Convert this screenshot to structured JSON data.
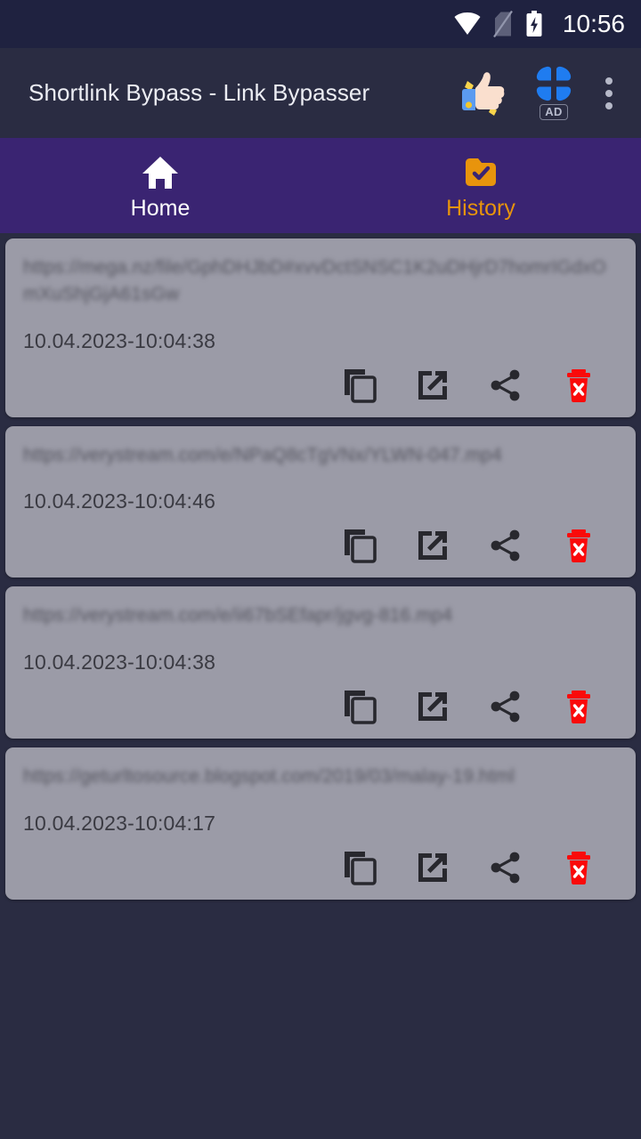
{
  "status_bar": {
    "clock": "10:56",
    "icons": [
      "wifi-icon",
      "sim-off-icon",
      "battery-charging-icon"
    ]
  },
  "app_bar": {
    "title": "Shortlink Bypass - Link Bypasser",
    "thumbs_up_icon": "thumbs-up-icon",
    "ad_icon": "ad-app-icon",
    "ad_badge_label": "AD",
    "overflow_icon": "more-vertical-icon"
  },
  "tabs": [
    {
      "label": "Home",
      "icon": "home-icon",
      "active": false
    },
    {
      "label": "History",
      "icon": "folder-check-icon",
      "active": true
    }
  ],
  "colors": {
    "status_bar_bg": "#1f2240",
    "app_bar_bg": "#2a2c42",
    "page_bg": "#2a2c42",
    "tab_bar_bg": "#3a2472",
    "tab_active": "#e8940c",
    "tab_inactive": "#ffffff",
    "card_bg": "#9b9ba7",
    "card_url_text": "#55555f",
    "card_date_text": "#3a3a42",
    "action_icon": "#28282e",
    "delete_icon": "#fa0a0a"
  },
  "actions": {
    "copy_label": "copy-icon",
    "open_label": "open-in-new-icon",
    "share_label": "share-icon",
    "delete_label": "delete-icon"
  },
  "history": [
    {
      "url": "https://mega.nz/file/GphDHJbD#xvvDctSNSC1K2uDHjrD7homrIGdxOmXuShjGjA61sGw",
      "date": "10.04.2023-10:04:38"
    },
    {
      "url": "https://verystream.com/e/NPaQ8cTgVNx/YLWN-047.mp4",
      "date": "10.04.2023-10:04:46"
    },
    {
      "url": "https://verystream.com/e/ii67bSEfapr/jgvg-816.mp4",
      "date": "10.04.2023-10:04:38"
    },
    {
      "url": "https://geturltosource.blogspot.com/2019/03/malay-19.html",
      "date": "10.04.2023-10:04:17"
    }
  ]
}
